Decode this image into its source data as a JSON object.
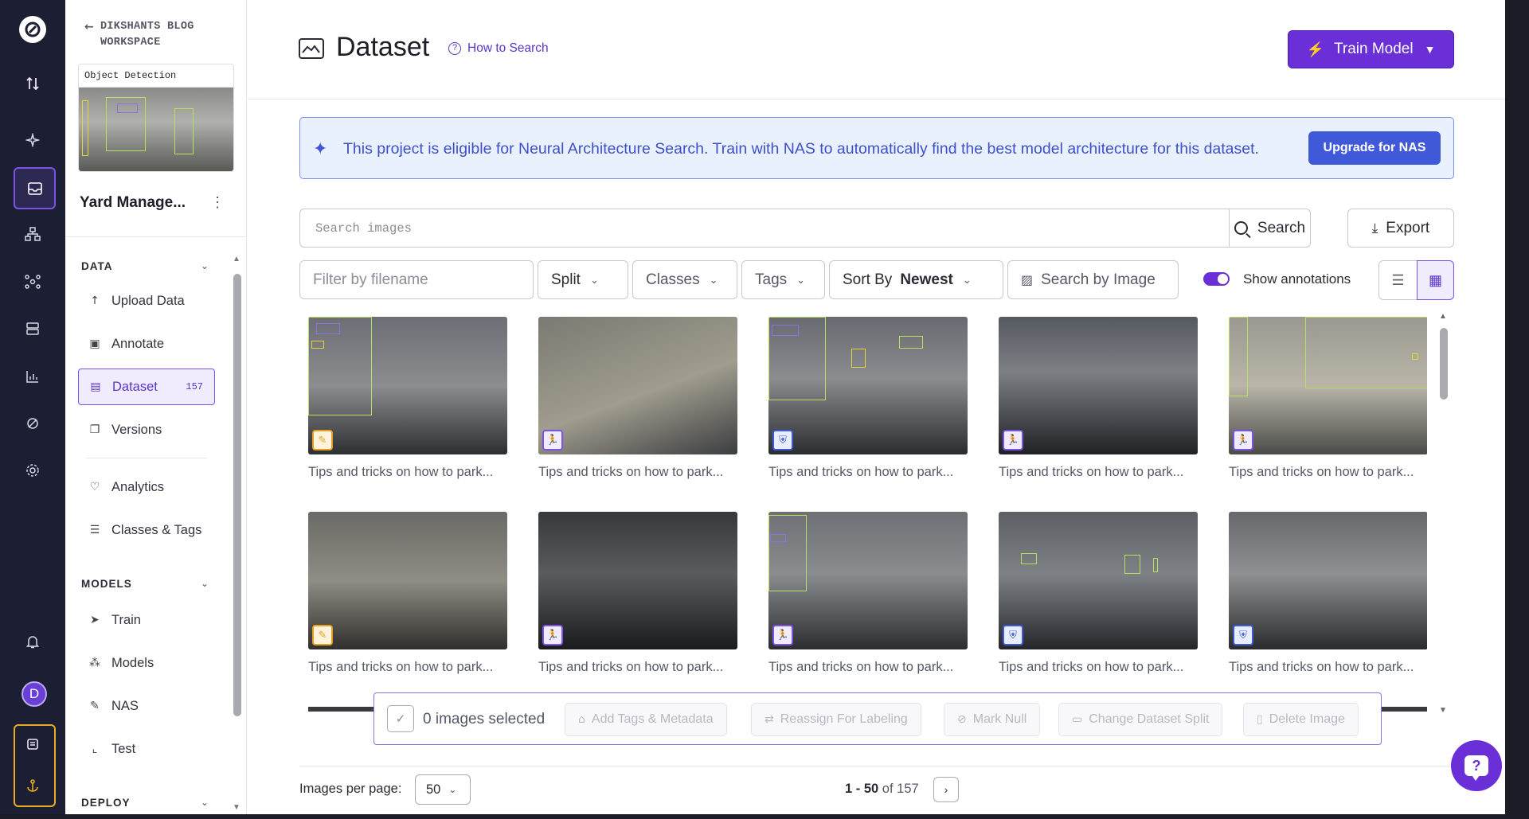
{
  "workspace": {
    "back_label": "DIKSHANTS BLOG WORKSPACE"
  },
  "project": {
    "type_label": "Object Detection",
    "name": "Yard Manage..."
  },
  "sidebar": {
    "sections": {
      "data": "DATA",
      "models": "MODELS",
      "deploy": "DEPLOY"
    },
    "data_items": [
      {
        "label": "Upload Data",
        "icon": "upload-icon"
      },
      {
        "label": "Annotate",
        "icon": "annotate-icon"
      },
      {
        "label": "Dataset",
        "icon": "dataset-icon",
        "count": "157",
        "active": true
      },
      {
        "label": "Versions",
        "icon": "versions-icon"
      },
      {
        "label": "Analytics",
        "icon": "analytics-icon"
      },
      {
        "label": "Classes & Tags",
        "icon": "classes-icon"
      }
    ],
    "model_items": [
      {
        "label": "Train",
        "icon": "train-icon"
      },
      {
        "label": "Models",
        "icon": "models-icon"
      },
      {
        "label": "NAS",
        "icon": "nas-icon"
      },
      {
        "label": "Test",
        "icon": "test-icon"
      }
    ]
  },
  "rail": {
    "avatar_letter": "D"
  },
  "header": {
    "title": "Dataset",
    "how_to_search": "How to Search",
    "train_button": "Train Model"
  },
  "banner": {
    "message": "This project is eligible for Neural Architecture Search. Train with NAS to automatically find the best model architecture for this dataset.",
    "button": "Upgrade for NAS"
  },
  "search": {
    "placeholder": "Search images",
    "search_button": "Search",
    "export_button": "Export"
  },
  "filters": {
    "filename_placeholder": "Filter by filename",
    "split": "Split",
    "classes": "Classes",
    "tags": "Tags",
    "sort_label": "Sort By",
    "sort_value": "Newest",
    "search_by_image": "Search by Image",
    "show_annotations": "Show annotations",
    "show_annotations_on": true
  },
  "images": [
    {
      "caption": "Tips and tricks on how to park...",
      "split": "annotate",
      "badge_color": "#e5a021"
    },
    {
      "caption": "Tips and tricks on how to park...",
      "split": "train",
      "badge_color": "#7c53e6"
    },
    {
      "caption": "Tips and tricks on how to park...",
      "split": "valid",
      "badge_color": "#3f59d9"
    },
    {
      "caption": "Tips and tricks on how to park...",
      "split": "train",
      "badge_color": "#7c53e6"
    },
    {
      "caption": "Tips and tricks on how to park...",
      "split": "train",
      "badge_color": "#7c53e6"
    },
    {
      "caption": "Tips and tricks on how to park...",
      "split": "annotate",
      "badge_color": "#e5a021"
    },
    {
      "caption": "Tips and tricks on how to park...",
      "split": "train",
      "badge_color": "#7c53e6"
    },
    {
      "caption": "Tips and tricks on how to park...",
      "split": "train",
      "badge_color": "#7c53e6"
    },
    {
      "caption": "Tips and tricks on how to park...",
      "split": "valid",
      "badge_color": "#3f59d9"
    },
    {
      "caption": "Tips and tricks on how to park...",
      "split": "valid",
      "badge_color": "#3f59d9"
    }
  ],
  "bulk": {
    "selected": "0 images selected",
    "add_tags": "Add Tags & Metadata",
    "reassign": "Reassign For Labeling",
    "mark_null": "Mark Null",
    "change_split": "Change Dataset Split",
    "delete": "Delete Image"
  },
  "pagination": {
    "per_page_label": "Images per page:",
    "per_page_value": "50",
    "range": "1 - 50",
    "of_label": "of 157"
  },
  "colors": {
    "accent": "#6a2fd6",
    "banner_text": "#3e51c8",
    "rail_bg": "#1c1f33"
  }
}
